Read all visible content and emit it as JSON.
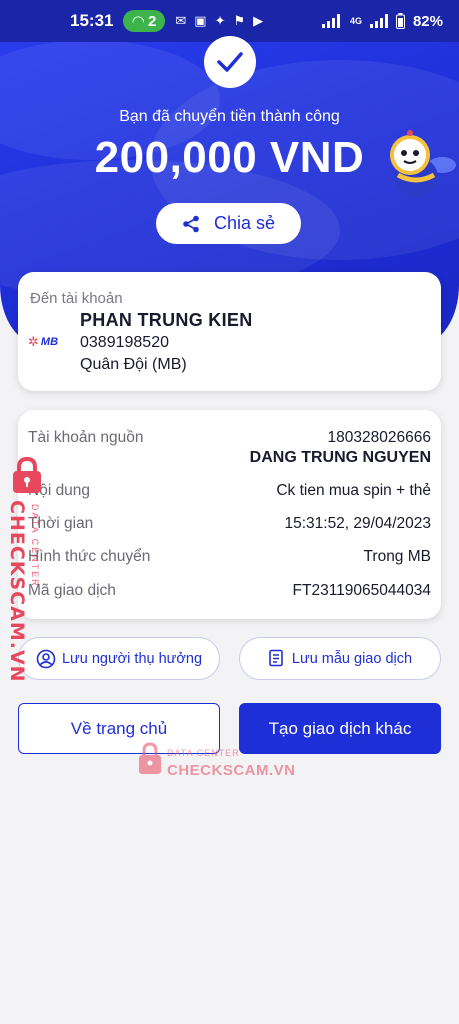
{
  "status_bar": {
    "time": "15:31",
    "hotspot_count": "2",
    "network": "4G",
    "battery": "82%"
  },
  "hero": {
    "success_message": "Bạn đã chuyển tiền thành công",
    "amount": "200,000 VND",
    "share_label": "Chia sẻ"
  },
  "recipient": {
    "section_label": "Đến tài khoản",
    "bank_logo_text": "MB",
    "name": "PHAN TRUNG KIEN",
    "account_number": "0389198520",
    "bank_name": "Quân Đội (MB)"
  },
  "details": {
    "source_label": "Tài khoản nguồn",
    "source_account": "180328026666",
    "source_name": "DANG TRUNG NGUYEN",
    "content_label": "Nội dung",
    "content_value": "Ck tien mua spin + thẻ",
    "time_label": "Thời gian",
    "time_value": "15:31:52, 29/04/2023",
    "method_label": "Hình thức chuyển",
    "method_value": "Trong MB",
    "txn_label": "Mã giao dịch",
    "txn_value": "FT23119065044034"
  },
  "actions": {
    "save_payee": "Lưu người thụ hưởng",
    "save_template": "Lưu mẫu giao dịch",
    "home": "Về trang chủ",
    "new_transaction": "Tạo giao dịch khác"
  },
  "watermark": {
    "brand": "CHECKSCAM.VN",
    "sub": "DATA CENTER"
  },
  "colors": {
    "primary": "#1f2fd8",
    "watermark": "#e8485e"
  }
}
